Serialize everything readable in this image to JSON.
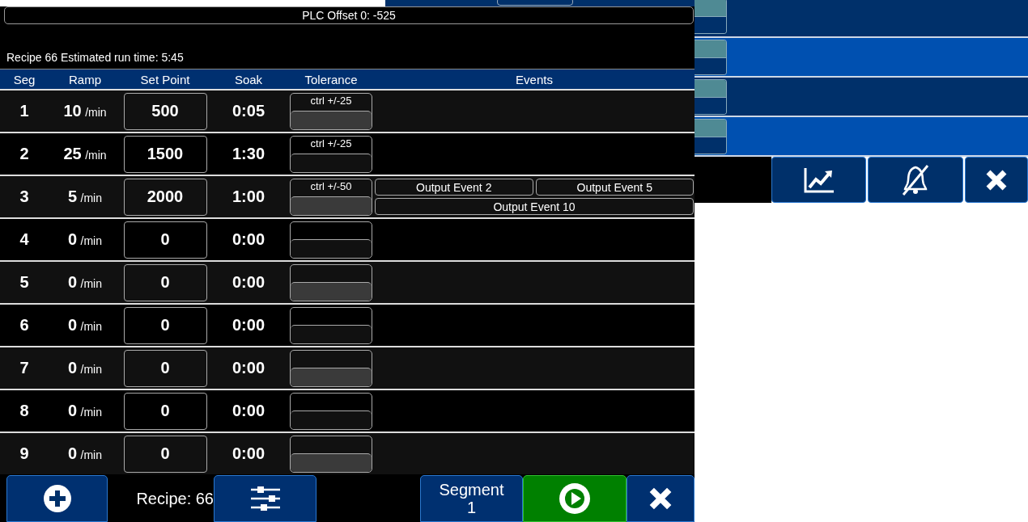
{
  "offset_bar": {
    "text": "PLC Offset 0: -525"
  },
  "estimate": "Recipe 66 Estimated run time: 5:45",
  "columns": [
    "Seg",
    "Ramp",
    "Set Point",
    "Soak",
    "Tolerance",
    "Events"
  ],
  "segments": [
    {
      "seg": "1",
      "ramp": "10",
      "ramp_unit": "/min",
      "set_point": "500",
      "soak": "0:05",
      "tolerance": "ctrl +/-25"
    },
    {
      "seg": "2",
      "ramp": "25",
      "ramp_unit": "/min",
      "set_point": "1500",
      "soak": "1:30",
      "tolerance": "ctrl +/-25"
    },
    {
      "seg": "3",
      "ramp": "5",
      "ramp_unit": "/min",
      "set_point": "2000",
      "soak": "1:00",
      "tolerance": "ctrl +/-50",
      "events": [
        "Output Event 2",
        "Output Event 5",
        "Output Event 10"
      ]
    },
    {
      "seg": "4",
      "ramp": "0",
      "ramp_unit": "/min",
      "set_point": "0",
      "soak": "0:00"
    },
    {
      "seg": "5",
      "ramp": "0",
      "ramp_unit": "/min",
      "set_point": "0",
      "soak": "0:00"
    },
    {
      "seg": "6",
      "ramp": "0",
      "ramp_unit": "/min",
      "set_point": "0",
      "soak": "0:00"
    },
    {
      "seg": "7",
      "ramp": "0",
      "ramp_unit": "/min",
      "set_point": "0",
      "soak": "0:00"
    },
    {
      "seg": "8",
      "ramp": "0",
      "ramp_unit": "/min",
      "set_point": "0",
      "soak": "0:00"
    },
    {
      "seg": "9",
      "ramp": "0",
      "ramp_unit": "/min",
      "set_point": "0",
      "soak": "0:00"
    }
  ],
  "footer": {
    "recipe": "Recipe: 66",
    "segment_label": "Segment",
    "segment_number": "1"
  }
}
